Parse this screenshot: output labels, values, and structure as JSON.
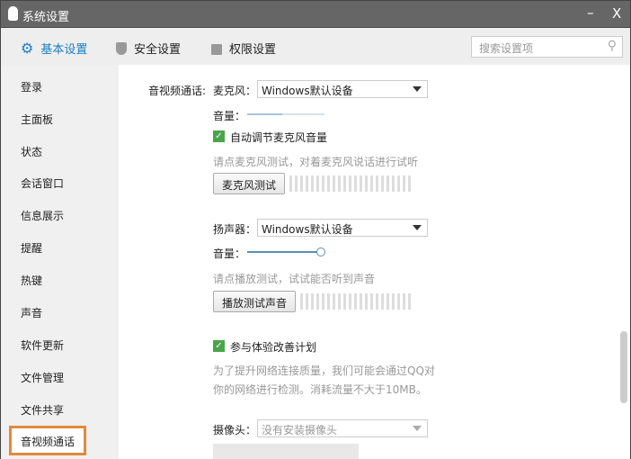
{
  "window": {
    "title": "系统设置",
    "minimize": "–",
    "close": "X"
  },
  "tabs": [
    {
      "label": "基本设置",
      "active": true
    },
    {
      "label": "安全设置"
    },
    {
      "label": "权限设置"
    }
  ],
  "search": {
    "placeholder": "搜索设置项"
  },
  "sidebar": {
    "items": [
      "登录",
      "主面板",
      "状态",
      "会话窗口",
      "信息展示",
      "提醒",
      "热键",
      "声音",
      "软件更新",
      "文件管理",
      "文件共享"
    ],
    "selected": "音视频通话"
  },
  "content": {
    "section_label": "音视频通话:",
    "mic": {
      "label": "麦克风：",
      "value": "Windows默认设备",
      "volume_label": "音量：",
      "volume": 0.45,
      "auto_label": "自动调节麦克风音量",
      "auto_checked": true,
      "hint": "请点麦克风测试，对着麦克风说话进行试听",
      "test_button": "麦克风测试"
    },
    "speaker": {
      "label": "扬声器：",
      "value": "Windows默认设备",
      "volume_label": "音量：",
      "volume": 1.0,
      "hint": "请点播放测试，试试能否听到声音",
      "test_button": "播放测试声音"
    },
    "improve": {
      "label": "参与体验改善计划",
      "checked": true,
      "desc1": "为了提升网络连接质量，我们可能会通过QQ对",
      "desc2": "你的网络进行检测。消耗流量不大于10MB。"
    },
    "camera": {
      "label": "摄像头：",
      "value": "没有安装摄像头"
    }
  },
  "colors": {
    "accent": "#1a7fc1",
    "selected_border": "#e08a3c",
    "check": "#4aa44a"
  }
}
